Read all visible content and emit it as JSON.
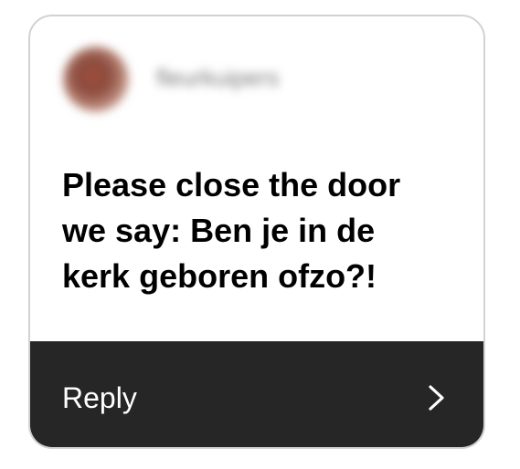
{
  "notification": {
    "username": "fleurkuipers",
    "message": "Please close the door\nwe say: Ben je in de\nkerk geboren ofzo?!",
    "reply_label": "Reply",
    "reply_icon": "chevron-right-icon"
  },
  "colors": {
    "footer_background": "#262626",
    "card_border": "#d2d2d4",
    "text": "#000000"
  }
}
